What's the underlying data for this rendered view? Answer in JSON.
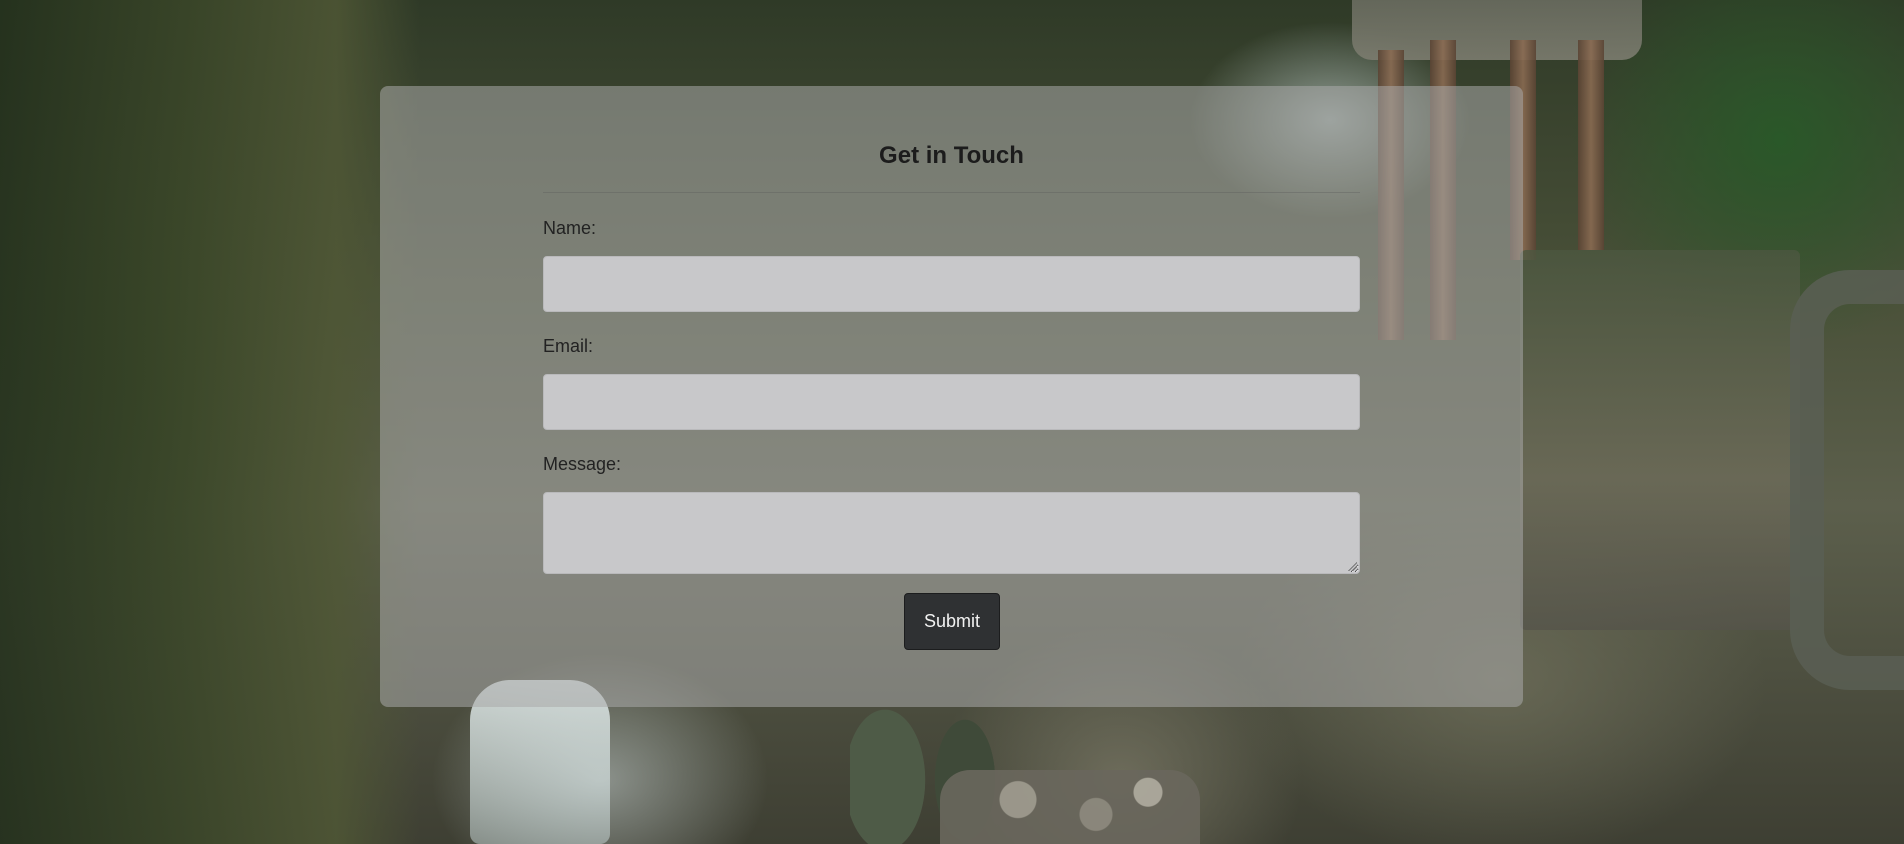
{
  "form": {
    "title": "Get in Touch",
    "fields": {
      "name": {
        "label": "Name:",
        "value": ""
      },
      "email": {
        "label": "Email:",
        "value": ""
      },
      "message": {
        "label": "Message:",
        "value": ""
      }
    },
    "submit_label": "Submit"
  },
  "colors": {
    "card_background": "#aaaaaa",
    "input_background": "#c8c8ca",
    "button_background": "#2f3133",
    "button_text": "#f2f2f2",
    "title_text": "#1c1c1c"
  }
}
